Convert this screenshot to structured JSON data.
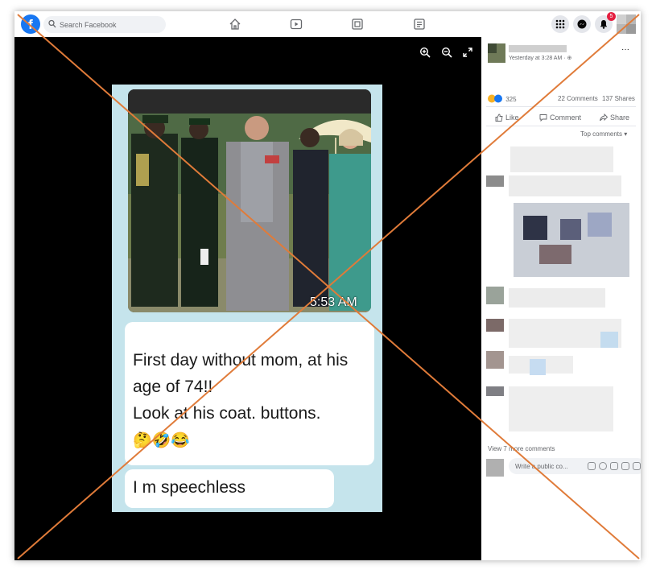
{
  "topbar": {
    "logo_letter": "f",
    "search_placeholder": "Search Facebook",
    "notifications_count": "5"
  },
  "post": {
    "timestamp": "Yesterday at 3:28 AM · ",
    "more_label": "···",
    "reaction_count": "325",
    "comments_count": "22 Comments",
    "shares_count": "137 Shares",
    "like_label": "Like",
    "comment_label": "Comment",
    "share_label": "Share",
    "sort_label": "Top comments",
    "view_more_label": "View 7 more comments",
    "comment_placeholder": "Write a public co..."
  },
  "image": {
    "photo_time": "5:53 AM",
    "message_lines": [
      "First day without mom, at his",
      "age of 74!!",
      "Look at his coat.  buttons."
    ],
    "emojis": [
      "🤔",
      "🤣",
      "😂"
    ],
    "second_message": "I m speechless"
  },
  "overlay": {
    "cross_color": "#e07b39"
  }
}
